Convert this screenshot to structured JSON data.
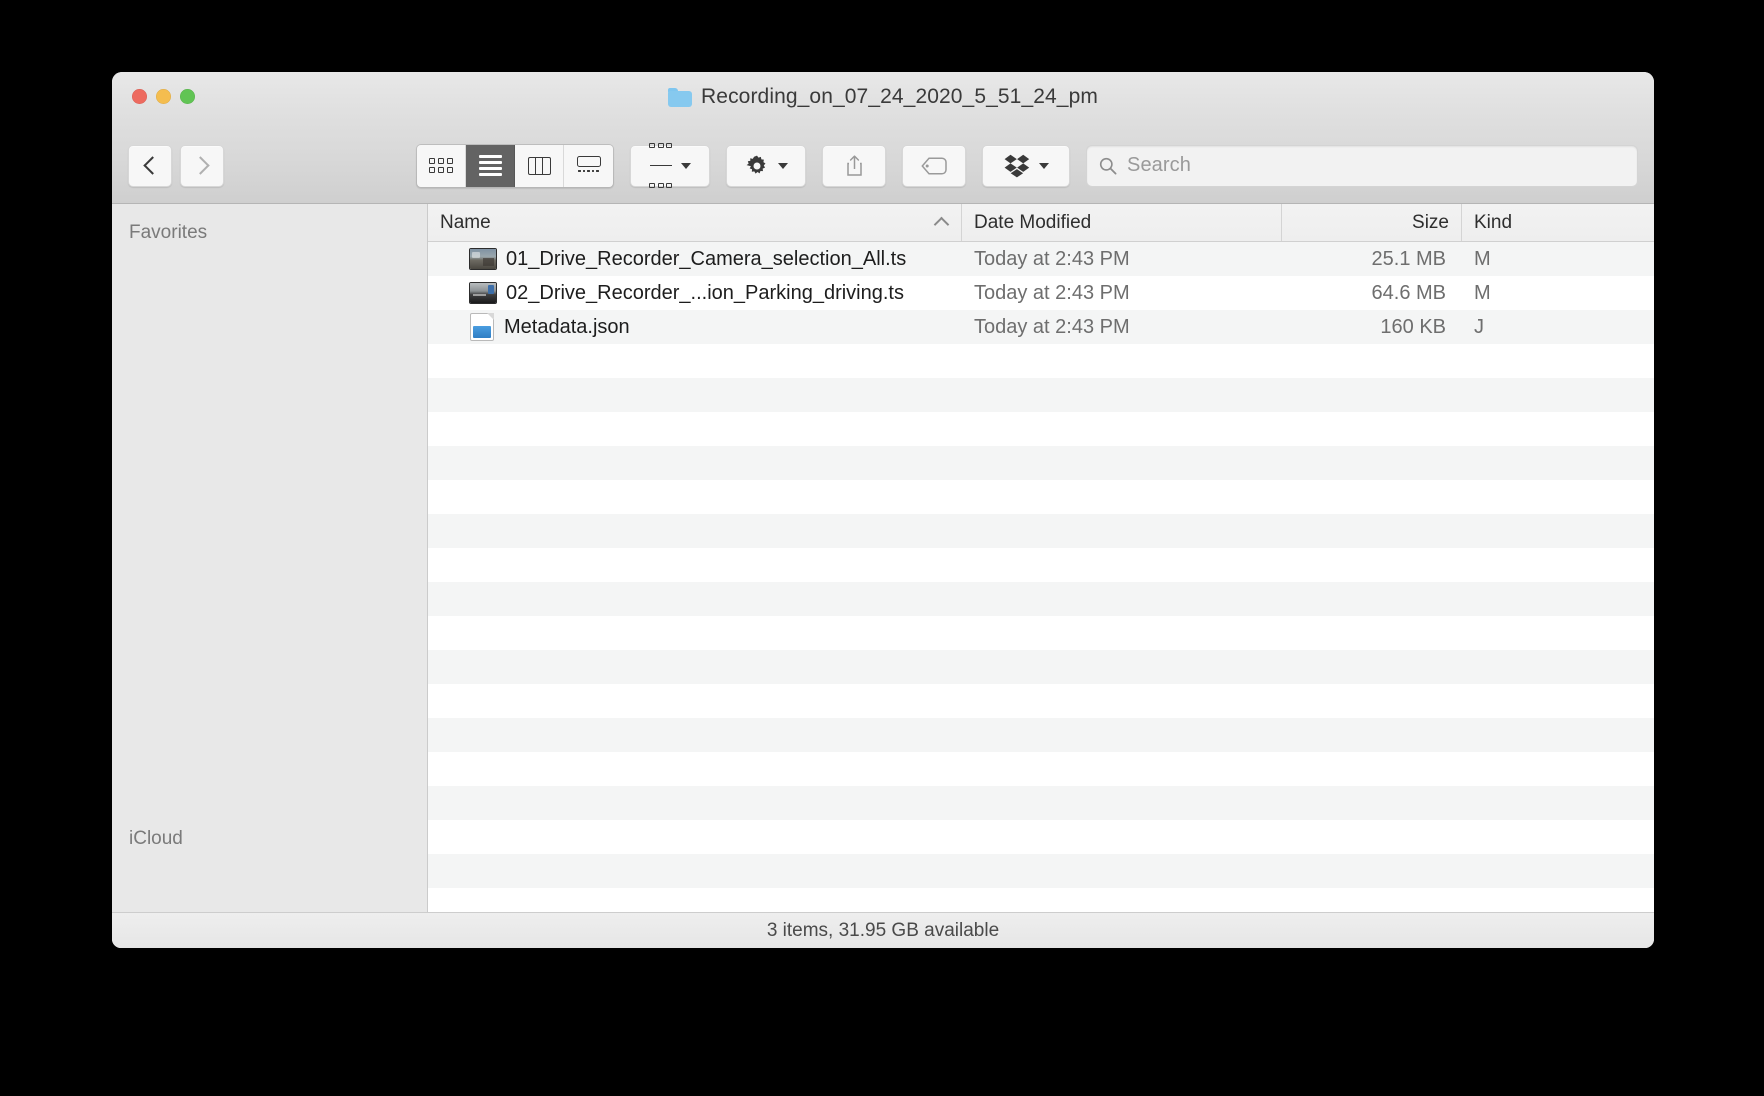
{
  "window": {
    "title": "Recording_on_07_24_2020_5_51_24_pm",
    "title_icon": "folder-icon",
    "traffic_lights": {
      "close": "close-button",
      "minimize": "minimize-button",
      "zoom": "zoom-button"
    }
  },
  "toolbar": {
    "back_label": "",
    "forward_label": "",
    "view_modes": [
      {
        "name": "icon-view",
        "active": false
      },
      {
        "name": "list-view",
        "active": true
      },
      {
        "name": "column-view",
        "active": false
      },
      {
        "name": "gallery-view",
        "active": false
      }
    ],
    "arrange_label": "",
    "action_label": "",
    "share_label": "",
    "tags_label": "",
    "dropbox_label": ""
  },
  "search": {
    "value": "",
    "placeholder": "Search"
  },
  "sidebar": {
    "sections": [
      {
        "label": "Favorites"
      },
      {
        "label": "iCloud"
      }
    ]
  },
  "filelist": {
    "columns": [
      {
        "label": "Name",
        "sorted": "asc"
      },
      {
        "label": "Date Modified",
        "sorted": ""
      },
      {
        "label": "Size",
        "sorted": ""
      },
      {
        "label": "Kind",
        "sorted": ""
      }
    ],
    "rows": [
      {
        "icon": "video-file-icon",
        "name": "01_Drive_Recorder_Camera_selection_All.ts",
        "date_modified": "Today at 2:43 PM",
        "size": "25.1 MB",
        "kind": "M"
      },
      {
        "icon": "video-file-icon",
        "name": "02_Drive_Recorder_...ion_Parking_driving.ts",
        "date_modified": "Today at 2:43 PM",
        "size": "64.6 MB",
        "kind": "M"
      },
      {
        "icon": "json-file-icon",
        "name": "Metadata.json",
        "date_modified": "Today at 2:43 PM",
        "size": "160 KB",
        "kind": "J"
      }
    ]
  },
  "statusbar": {
    "text": "3 items, 31.95 GB available"
  },
  "colors": {
    "close": "#ed6a5f",
    "minimize": "#f4bd4f",
    "zoom": "#61c454",
    "folder": "#86c9ef",
    "active_segment": "#636363",
    "desktop": "#000000"
  }
}
